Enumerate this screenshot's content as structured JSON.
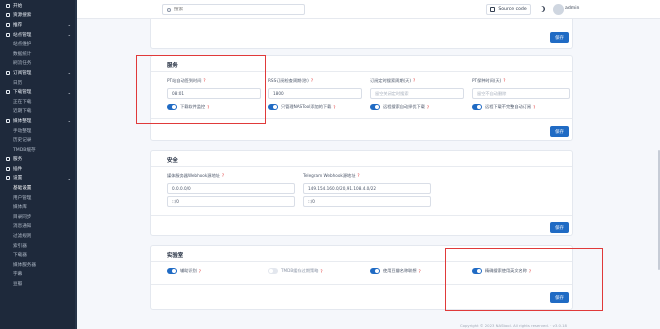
{
  "sidebar": {
    "items": [
      {
        "label": "开始",
        "type": "section"
      },
      {
        "label": "资源搜索",
        "type": "section"
      },
      {
        "label": "推荐",
        "type": "section",
        "chev": "⌄"
      },
      {
        "label": "站点管理",
        "type": "section",
        "chev": "⌄"
      },
      {
        "label": "站点维护",
        "type": "child"
      },
      {
        "label": "数据统计",
        "type": "child"
      },
      {
        "label": "刷流任务",
        "type": "child"
      },
      {
        "label": "订阅管理",
        "type": "section",
        "chev": "⌄"
      },
      {
        "label": "日历",
        "type": "child"
      },
      {
        "label": "下载管理",
        "type": "section",
        "chev": "⌄"
      },
      {
        "label": "正在下载",
        "type": "child"
      },
      {
        "label": "近期下载",
        "type": "child"
      },
      {
        "label": "媒体整理",
        "type": "section",
        "chev": "⌄"
      },
      {
        "label": "手动整理",
        "type": "child"
      },
      {
        "label": "历史记录",
        "type": "child"
      },
      {
        "label": "TMDB缓存",
        "type": "child"
      },
      {
        "label": "服务",
        "type": "section"
      },
      {
        "label": "插件",
        "type": "section"
      },
      {
        "label": "设置",
        "type": "section",
        "chev": "⌄"
      },
      {
        "label": "基础设置",
        "type": "child",
        "active": true
      },
      {
        "label": "用户管理",
        "type": "child"
      },
      {
        "label": "媒体库",
        "type": "child"
      },
      {
        "label": "目录同步",
        "type": "child"
      },
      {
        "label": "消息通知",
        "type": "child"
      },
      {
        "label": "过滤规则",
        "type": "child"
      },
      {
        "label": "索引器",
        "type": "child"
      },
      {
        "label": "下载器",
        "type": "child"
      },
      {
        "label": "媒体服务器",
        "type": "child"
      },
      {
        "label": "字幕",
        "type": "child"
      },
      {
        "label": "豆瓣",
        "type": "child"
      }
    ]
  },
  "header": {
    "search_placeholder": "搜索",
    "source_code_label": "Source code",
    "user_name": "admin"
  },
  "top_card": {
    "save_label": "保存"
  },
  "service_card": {
    "title": "服务",
    "fields": [
      {
        "label": "PT站自动签到时间",
        "value": "08:01",
        "placeholder": false
      },
      {
        "label": "RSS订阅检查周期(秒)",
        "value": "1800",
        "placeholder": false
      },
      {
        "label": "订阅定时搜索周期(天)",
        "value": "留空关闭定时搜索",
        "placeholder": true
      },
      {
        "label": "PT保种时间(天)",
        "value": "留空不自动删除",
        "placeholder": true
      }
    ],
    "toggles": [
      {
        "label": "下载软件监控",
        "on": true
      },
      {
        "label": "只管理NASTool添加的下载",
        "on": true
      },
      {
        "label": "远程搜索自动择优下载",
        "on": true
      },
      {
        "label": "远程下载不完整自动订阅",
        "on": true
      }
    ],
    "save_label": "保存"
  },
  "security_card": {
    "title": "安全",
    "webhook_label": "媒体服务器Webhook源地址",
    "webhook_values": [
      "0.0.0.0/0",
      "::/0"
    ],
    "telegram_label": "Telegram Webhook源地址",
    "telegram_values": [
      "149.154.160.0/20,91.108.4.0/22",
      "::/0"
    ],
    "save_label": "保存"
  },
  "lab_card": {
    "title": "实验室",
    "toggles": [
      {
        "label": "辅助识别",
        "on": true
      },
      {
        "label": "TMDB缓存过期策略",
        "on": false
      },
      {
        "label": "使用豆瓣名称联想",
        "on": true
      },
      {
        "label": "精确搜索使用英文名称",
        "on": true
      }
    ],
    "save_label": "保存"
  },
  "footer": {
    "text": "Copyright © 2023 NAStool. All rights reserved. · v3.0.18"
  },
  "colors": {
    "accent": "#206bc4",
    "highlight": "#e03a3a",
    "sidebar": "#1e293b"
  }
}
